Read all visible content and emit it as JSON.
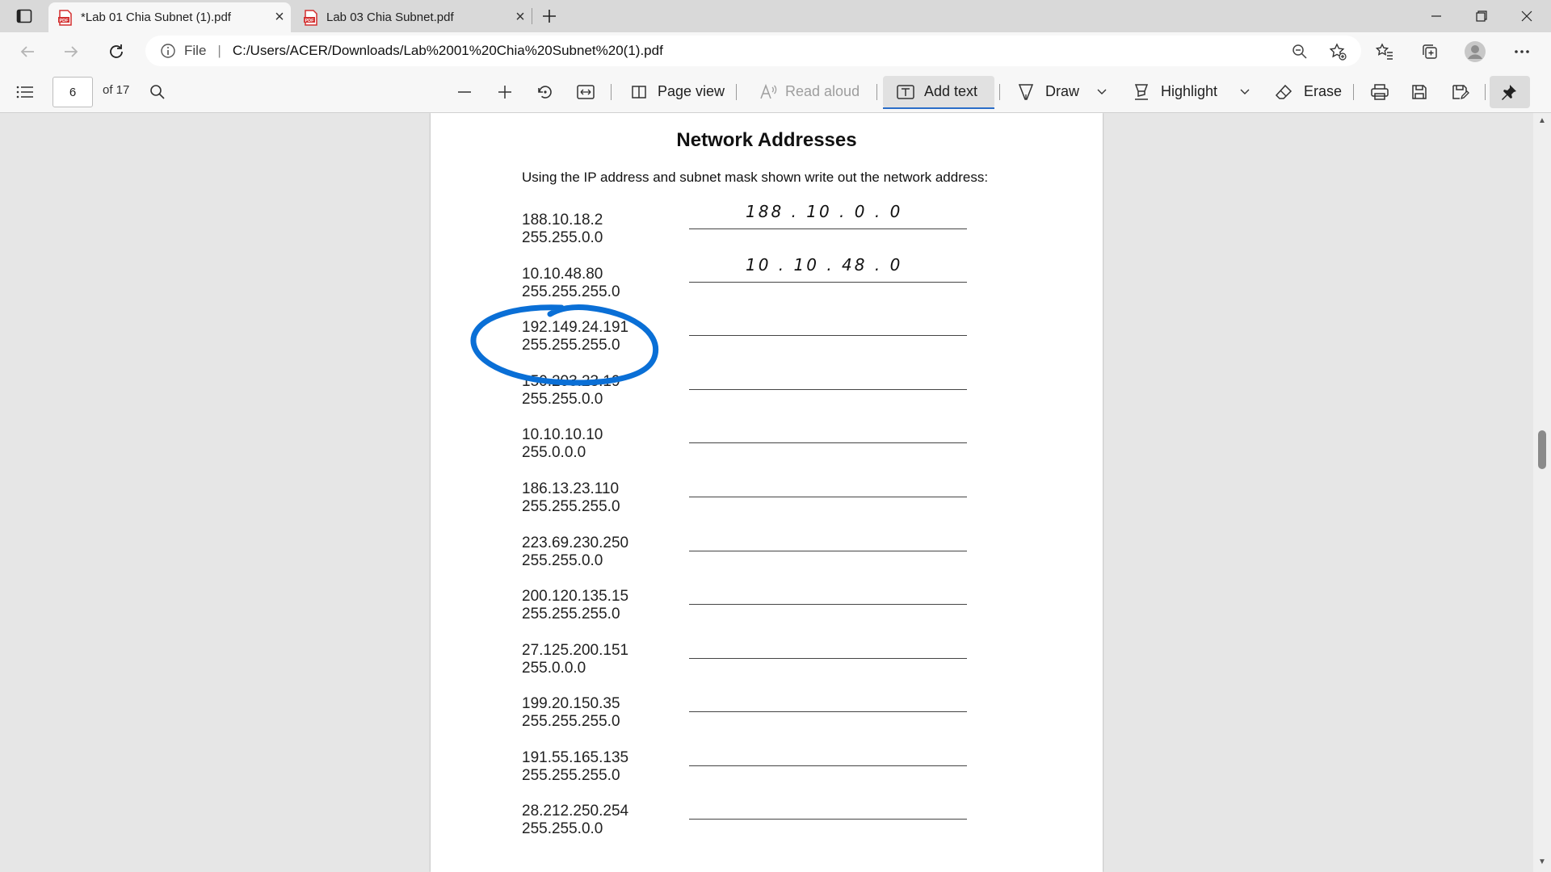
{
  "browser": {
    "tabs": [
      {
        "title": "*Lab 01 Chia Subnet (1).pdf",
        "icon": "pdf-file-icon",
        "active": true
      },
      {
        "title": "Lab 03 Chia Subnet.pdf",
        "icon": "pdf-file-icon",
        "active": false
      }
    ],
    "address": {
      "scheme_label": "File",
      "url": "C:/Users/ACER/Downloads/Lab%2001%20Chia%20Subnet%20(1).pdf"
    }
  },
  "pdf_toolbar": {
    "current_page": "6",
    "total_pages": "of 17",
    "page_view_label": "Page view",
    "read_aloud_label": "Read aloud",
    "add_text_label": "Add text",
    "draw_label": "Draw",
    "highlight_label": "Highlight",
    "erase_label": "Erase"
  },
  "document": {
    "title": "Network Addresses",
    "instructions": "Using the IP address and subnet mask shown write out the network address:",
    "entries": [
      {
        "ip": "188.10.18.2",
        "mask": "255.255.0.0",
        "answer": "188 . 10 . 0 . 0"
      },
      {
        "ip": "10.10.48.80",
        "mask": "255.255.255.0",
        "answer": "10 . 10 . 48 . 0"
      },
      {
        "ip": "192.149.24.191",
        "mask": "255.255.255.0",
        "answer": ""
      },
      {
        "ip": "150.203.23.19",
        "mask": "255.255.0.0",
        "answer": ""
      },
      {
        "ip": "10.10.10.10",
        "mask": "255.0.0.0",
        "answer": ""
      },
      {
        "ip": "186.13.23.110",
        "mask": "255.255.255.0",
        "answer": ""
      },
      {
        "ip": "223.69.230.250",
        "mask": "255.255.0.0",
        "answer": ""
      },
      {
        "ip": "200.120.135.15",
        "mask": "255.255.255.0",
        "answer": ""
      },
      {
        "ip": "27.125.200.151",
        "mask": "255.0.0.0",
        "answer": ""
      },
      {
        "ip": "199.20.150.35",
        "mask": "255.255.255.0",
        "answer": ""
      },
      {
        "ip": "191.55.165.135",
        "mask": "255.255.255.0",
        "answer": ""
      },
      {
        "ip": "28.212.250.254",
        "mask": "255.255.0.0",
        "answer": ""
      }
    ]
  },
  "colors": {
    "annotation_ink": "#0a6fd6",
    "add_text_accent": "#2a6dc8",
    "pdf_icon_red": "#d32f2f"
  }
}
